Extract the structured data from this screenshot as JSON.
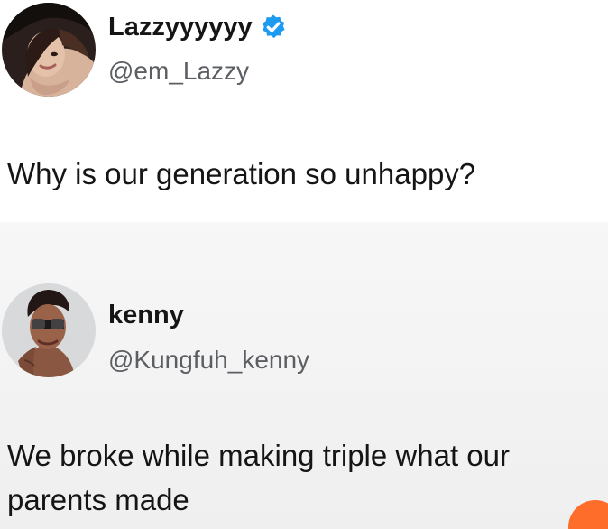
{
  "colors": {
    "verified": "#1d9bf0",
    "text": "#151515",
    "handle": "#5b5e62",
    "corner_badge": "#ff6d2b"
  },
  "original_tweet": {
    "display_name": "Lazzyyyyyy",
    "handle": "@em_Lazzy",
    "verified": true,
    "verified_icon": "verified-badge-icon",
    "avatar_icon": "profile-photo",
    "text": "Why is our generation so unhappy?"
  },
  "reply_tweet": {
    "display_name": "kenny",
    "handle": "@Kungfuh_kenny",
    "avatar_icon": "profile-photo",
    "text_lines": [
      "We broke while making triple what our",
      "parents made"
    ]
  }
}
